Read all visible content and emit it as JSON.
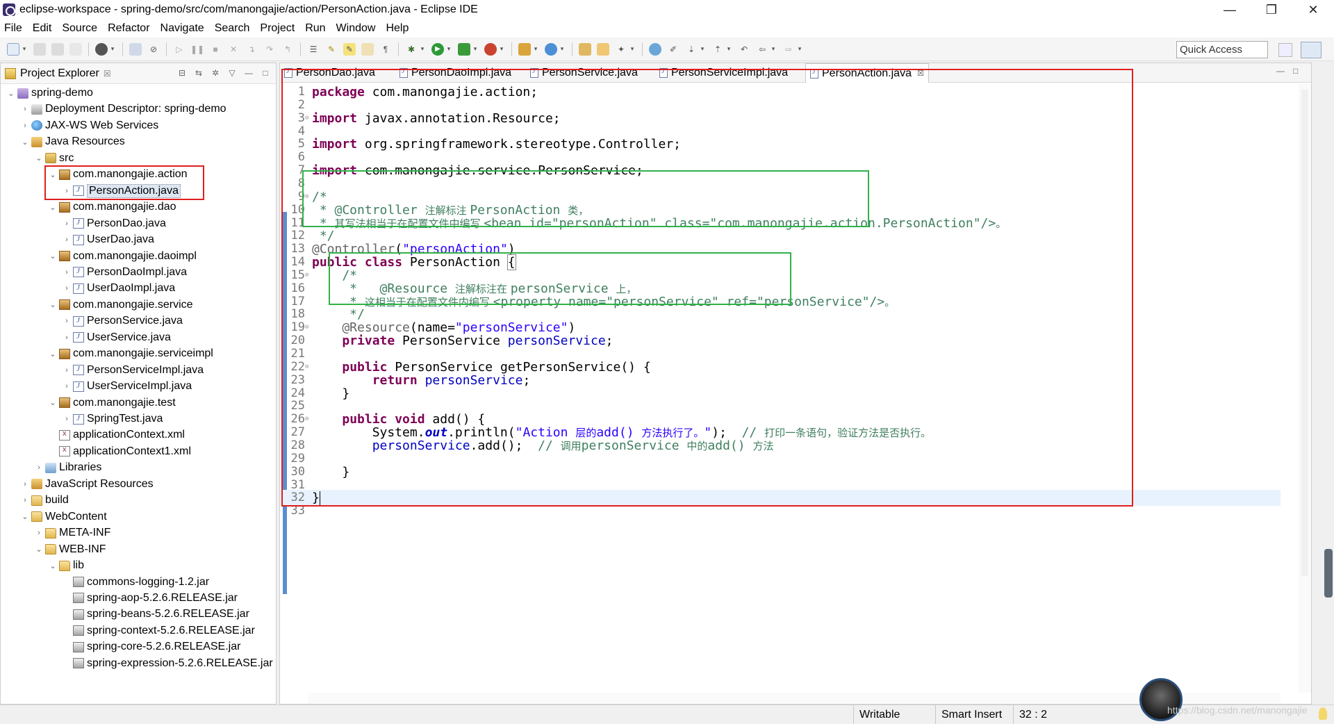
{
  "window": {
    "title": "eclipse-workspace - spring-demo/src/com/manongajie/action/PersonAction.java - Eclipse IDE",
    "minimize": "—",
    "restore": "❐",
    "close": "✕"
  },
  "menu": [
    "File",
    "Edit",
    "Source",
    "Refactor",
    "Navigate",
    "Search",
    "Project",
    "Run",
    "Window",
    "Help"
  ],
  "toolbar": {
    "quick_access": "Quick Access"
  },
  "explorer": {
    "title": "Project Explorer",
    "close": "☒",
    "nodes": [
      {
        "label": "spring-demo",
        "twisty": "⌄",
        "icon": "project-icon"
      },
      {
        "label": "Deployment Descriptor: spring-demo",
        "twisty": "›",
        "icon": "deployment-descriptor-icon"
      },
      {
        "label": "JAX-WS Web Services",
        "twisty": "›",
        "icon": "web-services-icon"
      },
      {
        "label": "Java Resources",
        "twisty": "⌄",
        "icon": "java-resources-icon"
      },
      {
        "label": "src",
        "twisty": "⌄",
        "icon": "source-folder-icon"
      },
      {
        "label": "com.manongajie.action",
        "twisty": "⌄",
        "icon": "package-icon"
      },
      {
        "label": "PersonAction.java",
        "twisty": "›",
        "icon": "java-file-icon"
      },
      {
        "label": "com.manongajie.dao",
        "twisty": "⌄",
        "icon": "package-icon"
      },
      {
        "label": "PersonDao.java",
        "twisty": "›",
        "icon": "java-file-icon"
      },
      {
        "label": "UserDao.java",
        "twisty": "›",
        "icon": "java-file-icon"
      },
      {
        "label": "com.manongajie.daoimpl",
        "twisty": "⌄",
        "icon": "package-icon"
      },
      {
        "label": "PersonDaoImpl.java",
        "twisty": "›",
        "icon": "java-file-icon"
      },
      {
        "label": "UserDaoImpl.java",
        "twisty": "›",
        "icon": "java-file-icon"
      },
      {
        "label": "com.manongajie.service",
        "twisty": "⌄",
        "icon": "package-icon"
      },
      {
        "label": "PersonService.java",
        "twisty": "›",
        "icon": "java-file-icon"
      },
      {
        "label": "UserService.java",
        "twisty": "›",
        "icon": "java-file-icon"
      },
      {
        "label": "com.manongajie.serviceimpl",
        "twisty": "⌄",
        "icon": "package-icon"
      },
      {
        "label": "PersonServiceImpl.java",
        "twisty": "›",
        "icon": "java-file-icon"
      },
      {
        "label": "UserServiceImpl.java",
        "twisty": "›",
        "icon": "java-file-icon"
      },
      {
        "label": "com.manongajie.test",
        "twisty": "⌄",
        "icon": "package-icon"
      },
      {
        "label": "SpringTest.java",
        "twisty": "›",
        "icon": "java-file-icon"
      },
      {
        "label": "applicationContext.xml",
        "twisty": "",
        "icon": "xml-file-icon"
      },
      {
        "label": "applicationContext1.xml",
        "twisty": "",
        "icon": "xml-file-icon"
      },
      {
        "label": "Libraries",
        "twisty": "›",
        "icon": "libraries-icon"
      },
      {
        "label": "JavaScript Resources",
        "twisty": "›",
        "icon": "javascript-resources-icon"
      },
      {
        "label": "build",
        "twisty": "›",
        "icon": "folder-icon"
      },
      {
        "label": "WebContent",
        "twisty": "⌄",
        "icon": "folder-icon"
      },
      {
        "label": "META-INF",
        "twisty": "›",
        "icon": "folder-icon"
      },
      {
        "label": "WEB-INF",
        "twisty": "⌄",
        "icon": "folder-icon"
      },
      {
        "label": "lib",
        "twisty": "⌄",
        "icon": "folder-icon"
      },
      {
        "label": "commons-logging-1.2.jar",
        "twisty": "",
        "icon": "jar-icon"
      },
      {
        "label": "spring-aop-5.2.6.RELEASE.jar",
        "twisty": "",
        "icon": "jar-icon"
      },
      {
        "label": "spring-beans-5.2.6.RELEASE.jar",
        "twisty": "",
        "icon": "jar-icon"
      },
      {
        "label": "spring-context-5.2.6.RELEASE.jar",
        "twisty": "",
        "icon": "jar-icon"
      },
      {
        "label": "spring-core-5.2.6.RELEASE.jar",
        "twisty": "",
        "icon": "jar-icon"
      },
      {
        "label": "spring-expression-5.2.6.RELEASE.jar",
        "twisty": "",
        "icon": "jar-icon"
      }
    ]
  },
  "editor": {
    "tabs": [
      "PersonDao.java",
      "PersonDaoImpl.java",
      "PersonService.java",
      "PersonServiceImpl.java",
      "PersonAction.java"
    ],
    "active_tab": "PersonAction.java",
    "tab_close": "☒",
    "lines": [
      {
        "n": "1",
        "fold": ""
      },
      {
        "n": "2",
        "fold": ""
      },
      {
        "n": "3",
        "fold": "⊝"
      },
      {
        "n": "4",
        "fold": ""
      },
      {
        "n": "5",
        "fold": ""
      },
      {
        "n": "6",
        "fold": ""
      },
      {
        "n": "7",
        "fold": ""
      },
      {
        "n": "8",
        "fold": ""
      },
      {
        "n": "9",
        "fold": "⊝"
      },
      {
        "n": "10",
        "fold": ""
      },
      {
        "n": "11",
        "fold": ""
      },
      {
        "n": "12",
        "fold": ""
      },
      {
        "n": "13",
        "fold": ""
      },
      {
        "n": "14",
        "fold": ""
      },
      {
        "n": "15",
        "fold": "⊝"
      },
      {
        "n": "16",
        "fold": ""
      },
      {
        "n": "17",
        "fold": ""
      },
      {
        "n": "18",
        "fold": ""
      },
      {
        "n": "19",
        "fold": "⊝"
      },
      {
        "n": "20",
        "fold": ""
      },
      {
        "n": "21",
        "fold": ""
      },
      {
        "n": "22",
        "fold": "⊝"
      },
      {
        "n": "23",
        "fold": ""
      },
      {
        "n": "24",
        "fold": ""
      },
      {
        "n": "25",
        "fold": ""
      },
      {
        "n": "26",
        "fold": "⊝"
      },
      {
        "n": "27",
        "fold": ""
      },
      {
        "n": "28",
        "fold": ""
      },
      {
        "n": "29",
        "fold": ""
      },
      {
        "n": "30",
        "fold": ""
      },
      {
        "n": "31",
        "fold": ""
      },
      {
        "n": "32",
        "fold": ""
      },
      {
        "n": "33",
        "fold": ""
      }
    ],
    "code": {
      "l1_kw": "package",
      "l1_rest": " com.manongajie.action;",
      "l3_kw": "import",
      "l3_rest": " javax.annotation.Resource;",
      "l5_kw": "import",
      "l5_rest": " org.springframework.stereotype.Controller;",
      "l7_kw": "import",
      "l7_rest": " com.manongajie.service.PersonService;",
      "l9": "/*",
      "l10_a": " * @Controller ",
      "l10_b": "注解标注 ",
      "l10_c": "PersonAction ",
      "l10_d": "类，",
      "l11_a": " * ",
      "l11_b": "其写法相当于在配置文件中编写 ",
      "l11_c": "<bean id=\"personAction\" class=\"com.manongajie.action.PersonAction\"/>",
      "l11_d": "。",
      "l12": " */",
      "l13_ann": "@Controller",
      "l13_p1": "(",
      "l13_str": "\"personAction\"",
      "l13_p2": ")",
      "l14_kw": "public class",
      "l14_rest": " PersonAction ",
      "l14_brace": "{",
      "l15": "    /*",
      "l16_a": "     *   @Resource ",
      "l16_b": "注解标注在 ",
      "l16_c": "personService ",
      "l16_d": "上，",
      "l17_a": "     * ",
      "l17_b": "这相当于在配置文件内编写 ",
      "l17_c": "<property name=\"personService\" ref=\"personService\"/>",
      "l17_d": "。",
      "l18": "     */",
      "l19_ann": "    @Resource",
      "l19_p1": "(name=",
      "l19_str": "\"personService\"",
      "l19_p2": ")",
      "l20_ind": "    ",
      "l20_kw": "private",
      "l20_rest": " PersonService ",
      "l20_fld": "personService",
      "l20_end": ";",
      "l22_ind": "    ",
      "l22_kw": "public",
      "l22_rest": " PersonService getPersonService() {",
      "l23_ind": "        ",
      "l23_kw": "return",
      "l23_sp": " ",
      "l23_fld": "personService",
      "l23_end": ";",
      "l24": "    }",
      "l26_ind": "    ",
      "l26_kw": "public void",
      "l26_rest": " add() {",
      "l27_a": "        System.",
      "l27_out": "out",
      "l27_b": ".println(",
      "l27_s1": "\"Action ",
      "l27_s2": "层的",
      "l27_s3": "add() ",
      "l27_s4": "方法执行了。",
      "l27_s5": "\"",
      "l27_c": ");  ",
      "l27_cm1": "// ",
      "l27_cm2": "打印一条语句，验证方法是否执行。",
      "l28_ind": "        ",
      "l28_fld": "personService",
      "l28_b": ".add();  ",
      "l28_cm1": "// ",
      "l28_cm2": "调用",
      "l28_cm3": "personService ",
      "l28_cm4": "中的",
      "l28_cm5": "add() ",
      "l28_cm6": "方法",
      "l30": "    }",
      "l32": "}"
    }
  },
  "status": {
    "writable": "Writable",
    "insert_mode": "Smart Insert",
    "position": "32 : 2"
  },
  "watermark": "https://blog.csdn.net/manongajie"
}
